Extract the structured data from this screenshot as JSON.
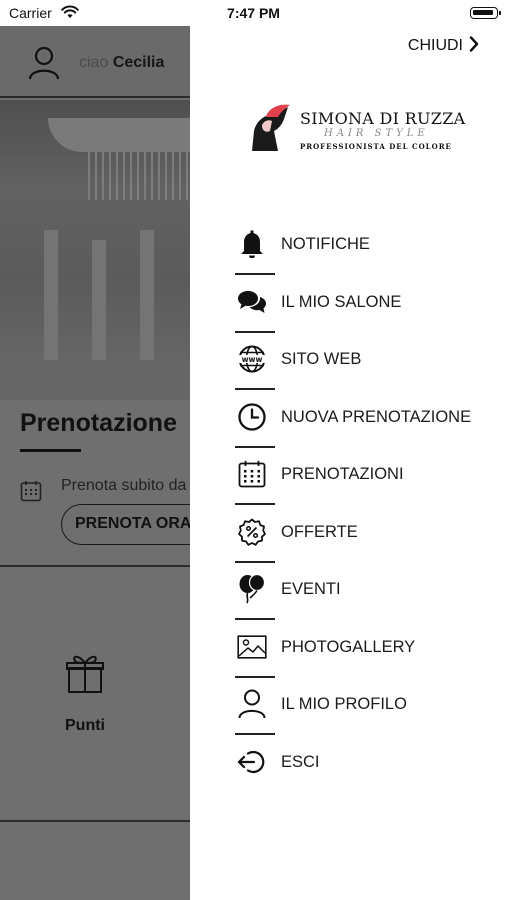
{
  "status_bar": {
    "carrier": "Carrier",
    "time": "7:47 PM"
  },
  "background": {
    "greeting_prefix": "ciao",
    "greeting_name": "Cecilia",
    "section_title": "Prenotazione",
    "prenota_text": "Prenota subito da",
    "prenota_button": "PRENOTA ORA",
    "punti_label": "Punti"
  },
  "drawer": {
    "close_label": "CHIUDI",
    "logo": {
      "name": "SIMONA DI RUZZA",
      "subtitle": "HAIR STYLE",
      "tagline": "PROFESSIONISTA DEL COLORE"
    },
    "menu": [
      {
        "label": "NOTIFICHE",
        "icon": "bell-icon"
      },
      {
        "label": "IL MIO SALONE",
        "icon": "chat-bubbles-icon"
      },
      {
        "label": "SITO WEB",
        "icon": "globe-www-icon"
      },
      {
        "label": "NUOVA PRENOTAZIONE",
        "icon": "clock-icon"
      },
      {
        "label": "PRENOTAZIONI",
        "icon": "calendar-icon"
      },
      {
        "label": "OFFERTE",
        "icon": "percent-badge-icon"
      },
      {
        "label": "EVENTI",
        "icon": "balloons-icon"
      },
      {
        "label": "PHOTOGALLERY",
        "icon": "image-icon"
      },
      {
        "label": "IL MIO PROFILO",
        "icon": "user-icon"
      },
      {
        "label": "ESCI",
        "icon": "logout-icon"
      }
    ]
  },
  "colors": {
    "overlay": "#6f6f6f",
    "drawer_bg": "#ffffff",
    "text": "#1b1b1b",
    "logo_accent": "#e0414b"
  }
}
